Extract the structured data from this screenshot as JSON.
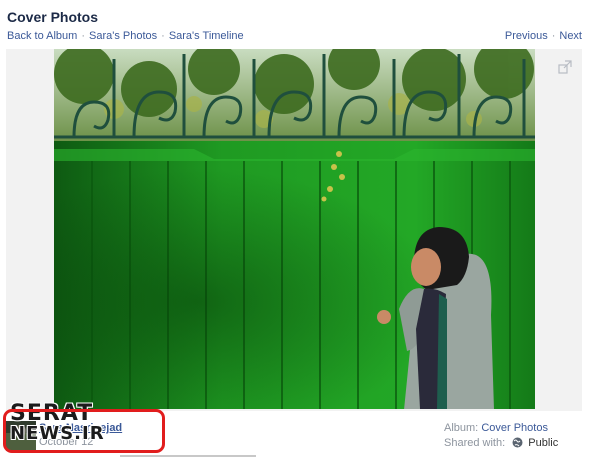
{
  "page": {
    "title": "Cover Photos"
  },
  "nav": {
    "back_to_album": "Back to Album",
    "separator": "·",
    "sara_photos": "Sara's Photos",
    "sara_timeline": "Sara's Timeline",
    "previous": "Previous",
    "next": "Next"
  },
  "uploader": {
    "name": "Sara Nasrinejad",
    "date": "October 12"
  },
  "meta": {
    "album_label": "Album:",
    "album_name": "Cover Photos",
    "shared_label": "Shared with:",
    "privacy": "Public"
  },
  "watermark": {
    "top": "SERAT",
    "bottom": "NEWS.IR"
  },
  "icons": {
    "expand": "expand-icon",
    "globe": "globe-icon"
  },
  "colors": {
    "link": "#3b5998",
    "highlight": "#e11d1d",
    "wall": "#1d8a1e"
  }
}
